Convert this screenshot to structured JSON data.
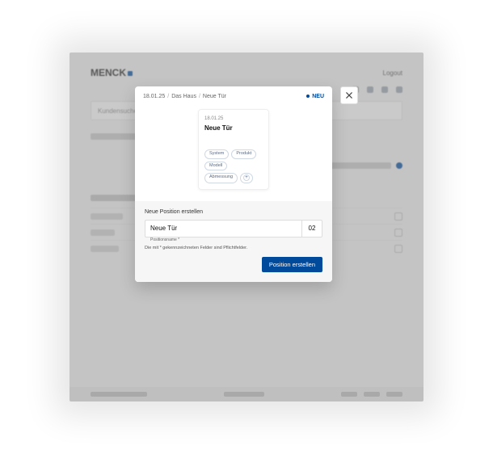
{
  "app": {
    "logo_text": "MENCK"
  },
  "header": {
    "logout_label": "Logout"
  },
  "search": {
    "placeholder": "Kundensuche"
  },
  "modal": {
    "breadcrumbs": [
      "18.01.25",
      "Das Haus",
      "Neue Tür"
    ],
    "new_badge": "NEU",
    "close_aria": "Close",
    "preview": {
      "date": "18.01.25",
      "title": "Neue Tür",
      "tags": [
        "System",
        "Produkt",
        "Modell",
        "Abmessung"
      ]
    },
    "form": {
      "heading": "Neue Position erstellen",
      "name_value": "Neue Tür",
      "name_label": "Positionsname *",
      "number_value": "02",
      "hint": "Die mit * gekennzeichneten Felder sind Pflichtfelder.",
      "submit_label": "Position erstellen"
    }
  }
}
